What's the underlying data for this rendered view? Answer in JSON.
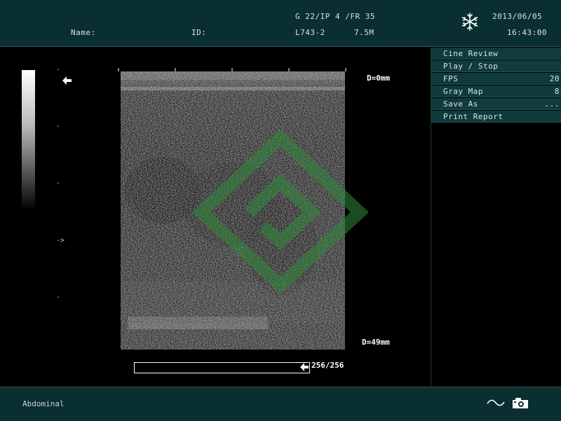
{
  "header": {
    "name_label": "Name:",
    "id_label": "ID:",
    "params_line1": "G 22/IP 4 /FR 35",
    "probe": "L743-2",
    "frequency": "7.5M",
    "date": "2013/06/05",
    "time": "16:43:00",
    "freeze_icon": "snowflake-icon"
  },
  "image": {
    "depth_top": "D=0mm",
    "depth_bottom": "D=49mm",
    "cine_counter": "256/256",
    "cine_progress": 1.0
  },
  "scale": {
    "marker": "->",
    "arrow_icon": "left-arrow-icon"
  },
  "menu": {
    "items": [
      {
        "label": "Cine Review",
        "value": ""
      },
      {
        "label": "Play / Stop",
        "value": ""
      },
      {
        "label": "FPS",
        "value": "20"
      },
      {
        "label": "Gray Map",
        "value": "8"
      },
      {
        "label": "Save As",
        "value": "..."
      },
      {
        "label": "Print Report",
        "value": ""
      }
    ]
  },
  "footer": {
    "preset": "Abdominal",
    "icons": [
      "wave-icon",
      "camera-icon"
    ]
  },
  "colors": {
    "header_bg": "#0a2f31",
    "menu_bg": "#103a3d",
    "watermark": "#2f8a3a"
  }
}
